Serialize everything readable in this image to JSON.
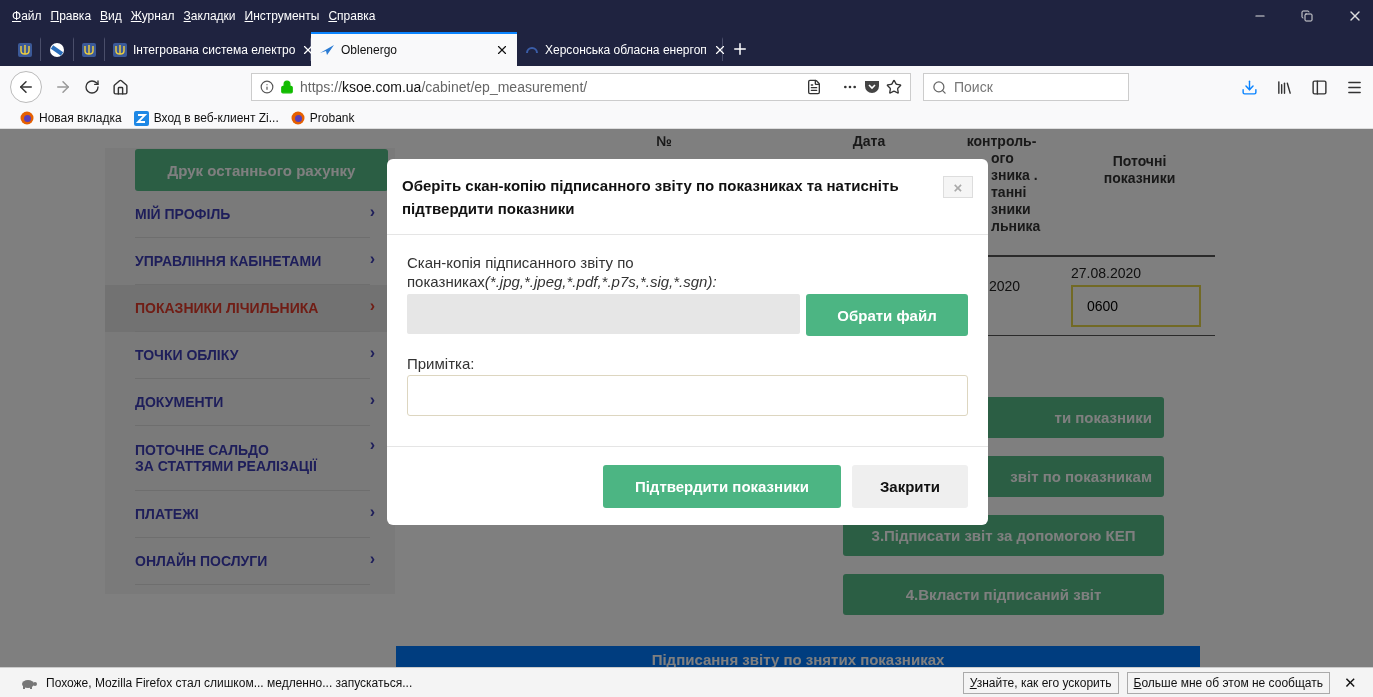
{
  "menu_bar": [
    "Файл",
    "Правка",
    "Вид",
    "Журнал",
    "Закладки",
    "Инструменты",
    "Справка"
  ],
  "tabs": [
    {
      "kind": "pinned",
      "selected": false
    },
    {
      "kind": "pinned",
      "selected": false
    },
    {
      "kind": "pinned",
      "selected": false
    },
    {
      "kind": "tab",
      "label": "Інтегрована система електро",
      "selected": false
    },
    {
      "kind": "tab",
      "label": "Oblenergo",
      "selected": true
    },
    {
      "kind": "tab",
      "label": "Херсонська обласна енергоп",
      "selected": false
    }
  ],
  "address": {
    "scheme": "https://",
    "host": "ksoe.com.ua",
    "path": "/cabinet/ep_measurement/"
  },
  "search": {
    "placeholder": "Поиск"
  },
  "bookmarks": [
    {
      "label": "Новая вкладка"
    },
    {
      "label": "Вход в веб-клиент Zi..."
    },
    {
      "label": "Probank"
    }
  ],
  "sidebar": {
    "print_button": "Друк останнього рахунку",
    "items": [
      {
        "label": "МІЙ ПРОФІЛЬ",
        "selected": false
      },
      {
        "label": "УПРАВЛІННЯ КАБІНЕТАМИ",
        "selected": false
      },
      {
        "label": "ПОКАЗНИКИ ЛІЧИЛЬНИКА",
        "selected": true
      },
      {
        "label": "ТОЧКИ ОБЛІКУ",
        "selected": false
      },
      {
        "label": "ДОКУМЕНТИ",
        "selected": false
      },
      {
        "label": "ПОТОЧНЕ САЛЬДО\nЗА СТАТТЯМИ РЕАЛІЗАЦІЇ",
        "selected": false
      },
      {
        "label": "ПЛАТЕЖІ",
        "selected": false
      },
      {
        "label": "ОНЛАЙН ПОСЛУГИ",
        "selected": false
      }
    ],
    "chevron": "›"
  },
  "table": {
    "columns": [
      {
        "lines": [
          "№"
        ]
      },
      {
        "lines": [
          "Дата"
        ]
      },
      {
        "lines": [
          "контроль-",
          "ого",
          "зника .",
          "танні",
          "зники",
          "льника"
        ]
      },
      {
        "lines": [
          "Поточні",
          "показники"
        ]
      }
    ],
    "row": {
      "column_5": "2020",
      "current_date": "27.08.2020",
      "current_value": "0600"
    }
  },
  "steps": [
    "ти показники",
    "звіт по показникам",
    "3.Підписати звіт за допомогою КЕП",
    "4.Вкласти підписаний звіт"
  ],
  "banner": "Підписання звіту по знятих показниках",
  "modal": {
    "title": "Оберіть скан-копію підписанного звіту по показниках та натисніть підтвердити показники",
    "close": "×",
    "file_label": "Скан-копія підписанного звіту по показниках",
    "file_formats": "(*.jpg,*.jpeg,*.pdf,*.p7s,*.sig,*.sgn):",
    "choose_button": "Обрати файл",
    "note_label": "Примітка:",
    "confirm_button": "Підтвердити показники",
    "close_button": "Закрити"
  },
  "notification": {
    "message": "Похоже, Mozilla Firefox стал слишком... медленно... запускаться...",
    "buttons": [
      "Узнайте, как его ускорить",
      "Больше мне об этом не сообщать"
    ],
    "close": "✕"
  }
}
